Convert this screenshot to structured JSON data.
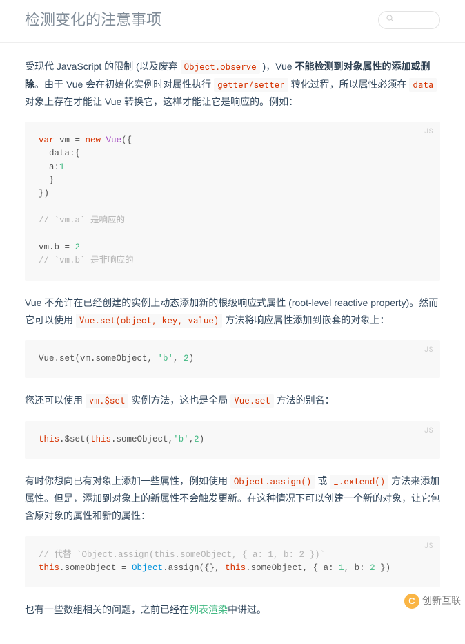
{
  "header": {
    "title": "检测变化的注意事项"
  },
  "paragraphs": {
    "p1": {
      "t1": "受现代 JavaScript 的限制 (以及废弃 ",
      "code1": "Object.observe",
      "t2": " )，Vue ",
      "strong1": "不能检测到对象属性的添加或删除",
      "t3": "。由于 Vue 会在初始化实例时对属性执行 ",
      "code2": "getter/setter",
      "t4": " 转化过程，所以属性必须在 ",
      "code3": "data",
      "t5": " 对象上存在才能让 Vue 转换它，这样才能让它是响应的。例如："
    },
    "p2": {
      "t1": "Vue 不允许在已经创建的实例上动态添加新的根级响应式属性 (root-level reactive property)。然而它可以使用 ",
      "code1": "Vue.set(object, key, value)",
      "t2": " 方法将响应属性添加到嵌套的对象上："
    },
    "p3": {
      "t1": "您还可以使用 ",
      "code1": "vm.$set",
      "t2": " 实例方法，这也是全局 ",
      "code2": "Vue.set",
      "t3": " 方法的别名："
    },
    "p4": {
      "t1": "有时你想向已有对象上添加一些属性，例如使用 ",
      "code1": "Object.assign()",
      "t2": " 或 ",
      "code2": "_.extend()",
      "t3": " 方法来添加属性。但是，添加到对象上的新属性不会触发更新。在这种情况下可以创建一个新的对象，让它包含原对象的属性和新的属性："
    },
    "p5": {
      "t1": "也有一些数组相关的问题，之前已经在",
      "link": "列表渲染",
      "t2": "中讲过。"
    }
  },
  "code": {
    "lang": "JS",
    "block1_tokens": {
      "k_var": "var",
      "k_new": "new",
      "lit_vue": "Vue",
      "num_1": "1",
      "num_2": "2",
      "c1": "// `vm.a` 是响应的",
      "c2": "// `vm.b` 是非响应的"
    },
    "block2_tokens": {
      "s_b": "'b'",
      "num_2": "2"
    },
    "block3_tokens": {
      "k_this": "this",
      "s_b": "'b'",
      "num_2": "2"
    },
    "block4_tokens": {
      "c1": "// 代替 `Object.assign(this.someObject, { a: 1, b: 2 })`",
      "k_this": "this",
      "b_object": "Object",
      "num_1": "1",
      "num_2": "2"
    }
  },
  "watermark": {
    "logo_letter": "C",
    "text": "创新互联"
  }
}
